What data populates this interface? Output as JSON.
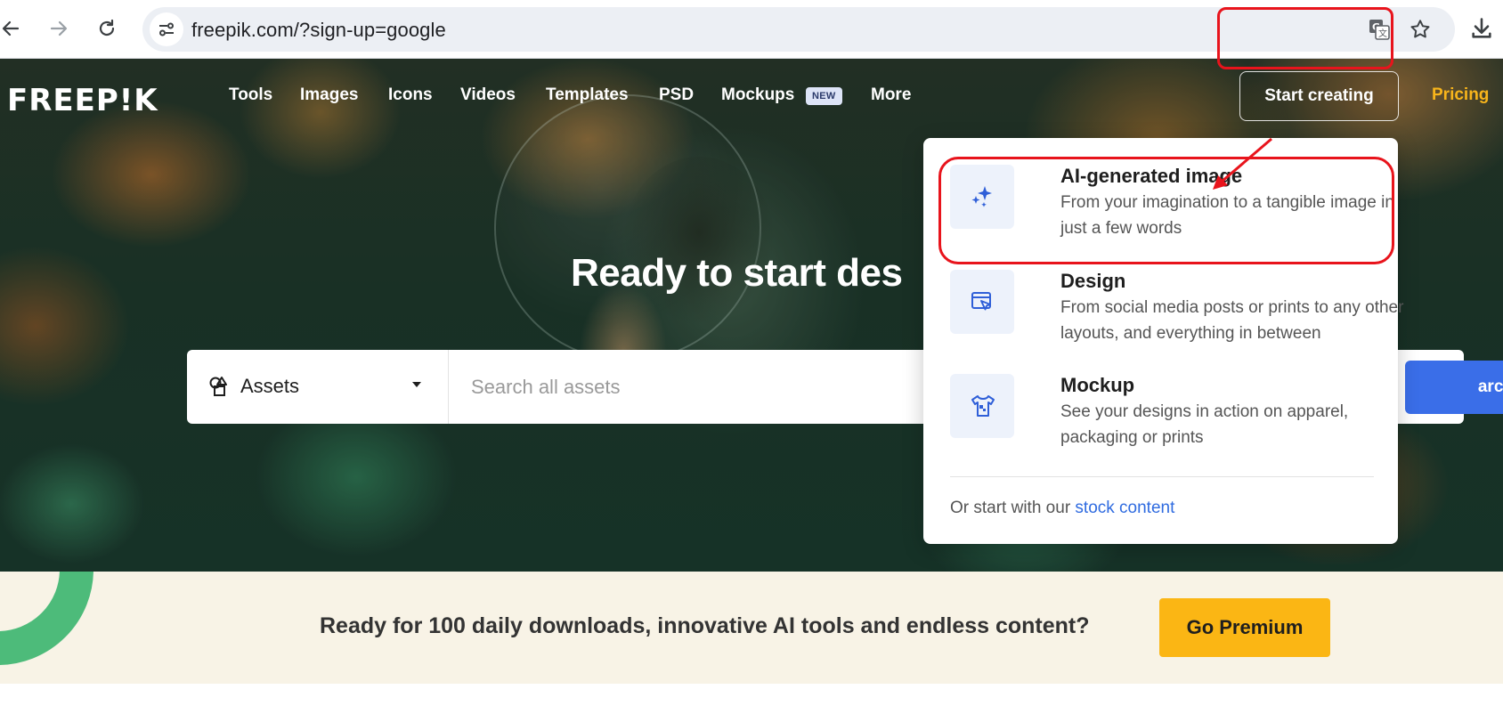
{
  "browser": {
    "url": "freepik.com/?sign-up=google",
    "icons": [
      "back-arrow-icon",
      "forward-arrow-icon",
      "reload-icon",
      "site-info-icon",
      "translate-icon",
      "bookmark-star-icon",
      "download-icon"
    ]
  },
  "header": {
    "logo": "FREEP!K",
    "nav": [
      "Tools",
      "Images",
      "Icons",
      "Videos",
      "Templates",
      "PSD",
      "Mockups",
      "More"
    ],
    "new_badge": "NEW",
    "start_creating": "Start creating",
    "pricing": "Pricing"
  },
  "hero": {
    "title": "Ready to start des",
    "search": {
      "category": "Assets",
      "placeholder": "Search all assets",
      "button": "arch"
    }
  },
  "dropdown": {
    "items": [
      {
        "title": "AI-generated image",
        "desc": "From your imagination to a tangible image in just a few words",
        "icon": "sparkles-icon"
      },
      {
        "title": "Design",
        "desc": "From social media posts or prints to any other layouts, and everything in between",
        "icon": "design-cursor-icon"
      },
      {
        "title": "Mockup",
        "desc": "See your designs in action on apparel, packaging or prints",
        "icon": "tshirt-mockup-icon"
      }
    ],
    "footer_prefix": "Or start with our ",
    "footer_link": "stock content"
  },
  "banner": {
    "text": "Ready for 100 daily downloads, innovative AI tools and endless content?",
    "button": "Go Premium"
  },
  "colors": {
    "accent_blue": "#3a6ee8",
    "pricing_gold": "#f8b51b",
    "premium_yellow": "#fbb614",
    "annotation_red": "#e8141c",
    "banner_bg": "#f8f3e6"
  }
}
